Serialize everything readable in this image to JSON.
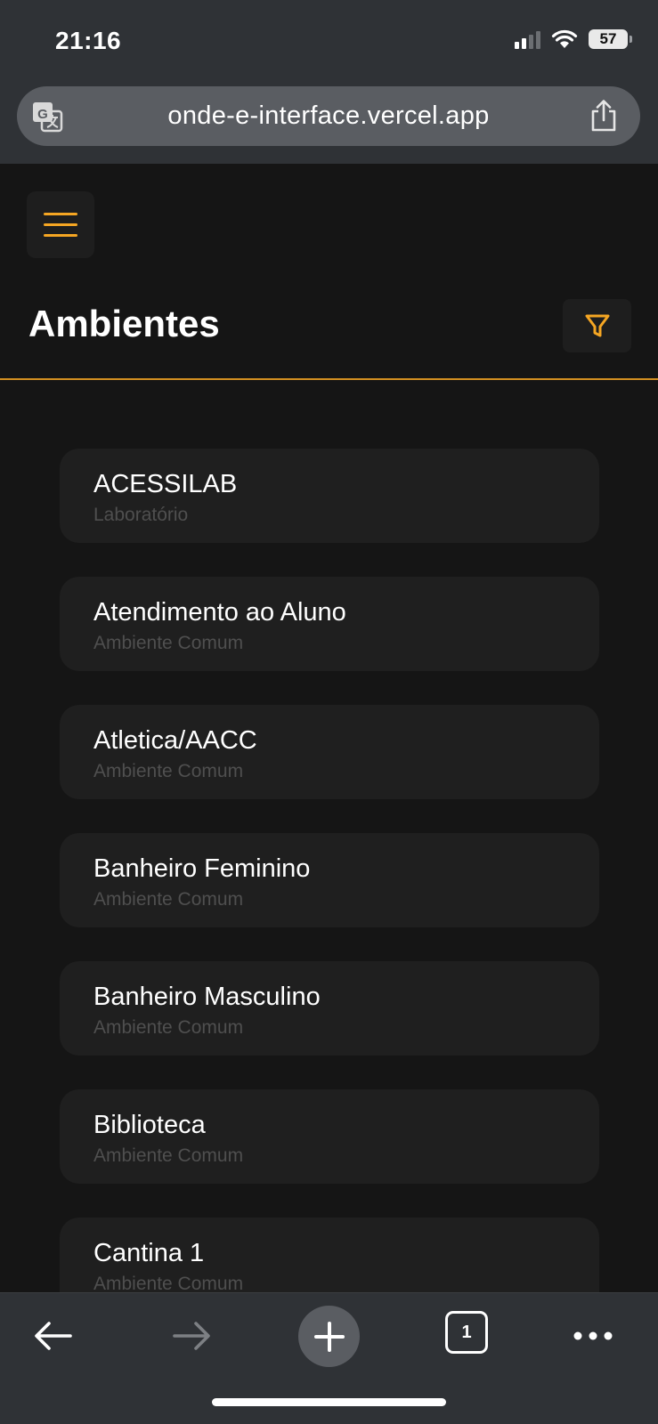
{
  "status_bar": {
    "time": "21:16",
    "battery": "57"
  },
  "browser": {
    "url": "onde-e-interface.vercel.app",
    "tab_count": "1"
  },
  "header": {
    "title": "Ambientes"
  },
  "colors": {
    "accent": "#f5a623",
    "background": "#151515",
    "card": "#1f1f1f",
    "chrome": "#2f3236"
  },
  "icons": {
    "translate": "translate-icon",
    "share": "share-icon",
    "menu": "hamburger-icon",
    "filter": "filter-icon",
    "back": "arrow-left-icon",
    "forward": "arrow-right-icon",
    "new_tab": "plus-icon",
    "more": "more-icon"
  },
  "rooms": [
    {
      "name": "ACESSILAB",
      "type": "Laboratório"
    },
    {
      "name": "Atendimento ao Aluno",
      "type": "Ambiente Comum"
    },
    {
      "name": "Atletica/AACC",
      "type": "Ambiente Comum"
    },
    {
      "name": "Banheiro Feminino",
      "type": "Ambiente Comum"
    },
    {
      "name": "Banheiro Masculino",
      "type": "Ambiente Comum"
    },
    {
      "name": "Biblioteca",
      "type": "Ambiente Comum"
    },
    {
      "name": "Cantina 1",
      "type": "Ambiente Comum"
    }
  ]
}
